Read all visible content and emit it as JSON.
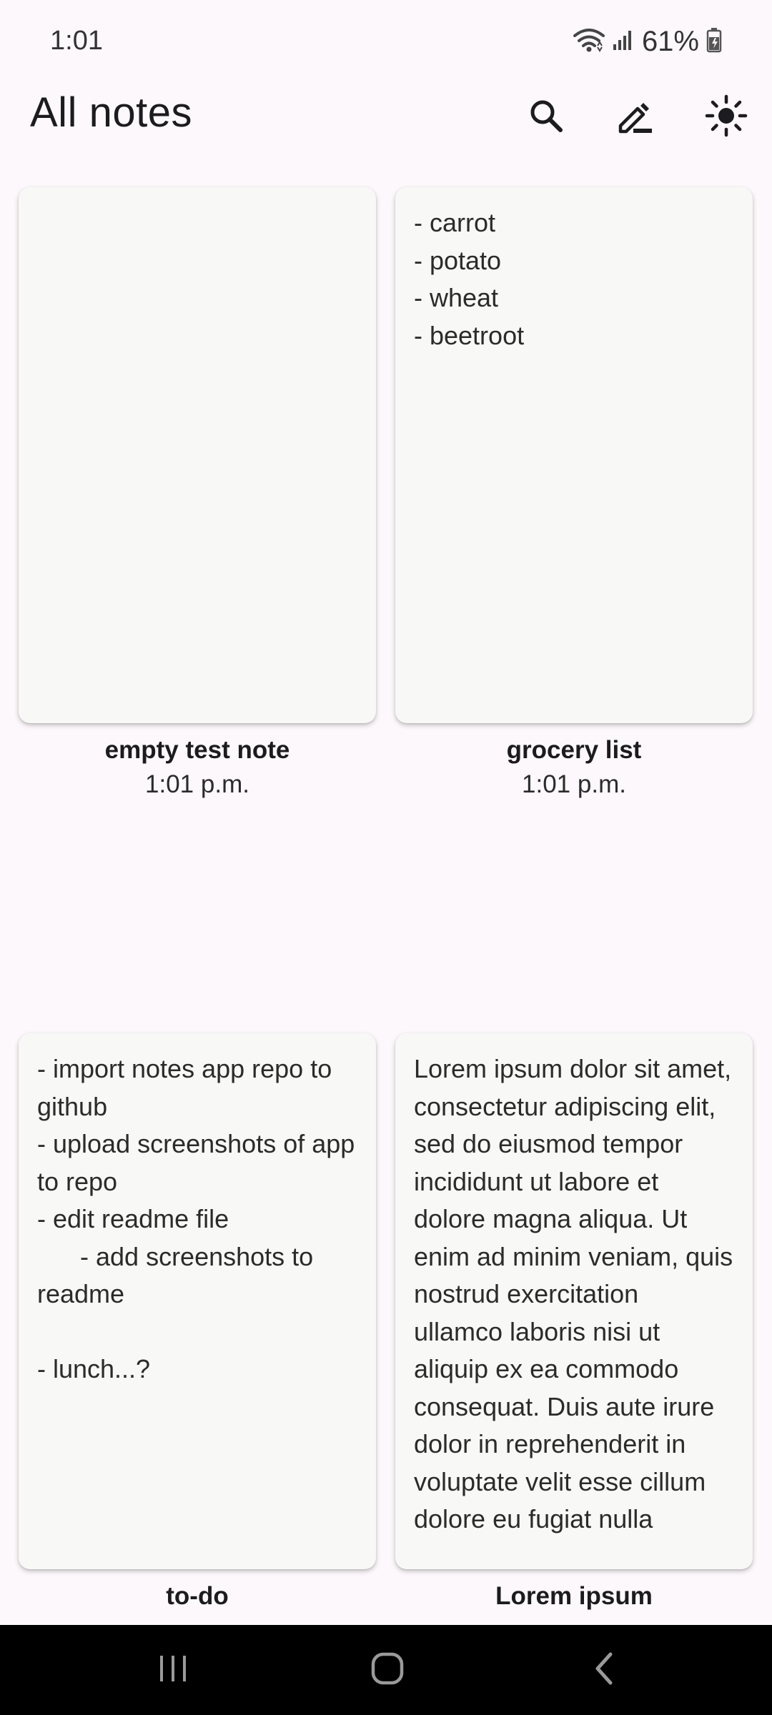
{
  "status_bar": {
    "time": "1:01",
    "battery": "61%",
    "icons": [
      "wifi-icon",
      "signal-icon",
      "battery-icon"
    ]
  },
  "app_bar": {
    "title": "All notes",
    "actions": [
      "search-icon",
      "edit-icon",
      "brightness-icon"
    ]
  },
  "notes": [
    {
      "title": "empty test note",
      "time": "1:01 p.m.",
      "body": ""
    },
    {
      "title": "grocery list",
      "time": "1:01 p.m.",
      "body": "- carrot\n- potato\n- wheat\n- beetroot"
    },
    {
      "title": "to-do",
      "time": "",
      "body": "- import notes app repo to github\n- upload screenshots of app to repo\n- edit readme file\n      - add screenshots to readme\n\n- lunch...?"
    },
    {
      "title": "Lorem ipsum",
      "time": "",
      "body": "Lorem ipsum dolor sit amet, consectetur adipiscing elit, sed do eiusmod tempor incididunt ut labore et dolore magna aliqua. Ut enim ad minim veniam, quis nostrud exercitation ullamco laboris nisi ut aliquip ex ea commodo consequat. Duis aute irure dolor in reprehenderit in voluptate velit esse cillum dolore eu fugiat nulla"
    }
  ],
  "nav_bar": {
    "buttons": [
      "recents-icon",
      "home-icon",
      "back-icon"
    ]
  },
  "colors": {
    "background": "#fdf8fb",
    "card": "#f8f8f7",
    "nav_bar": "#000000"
  }
}
